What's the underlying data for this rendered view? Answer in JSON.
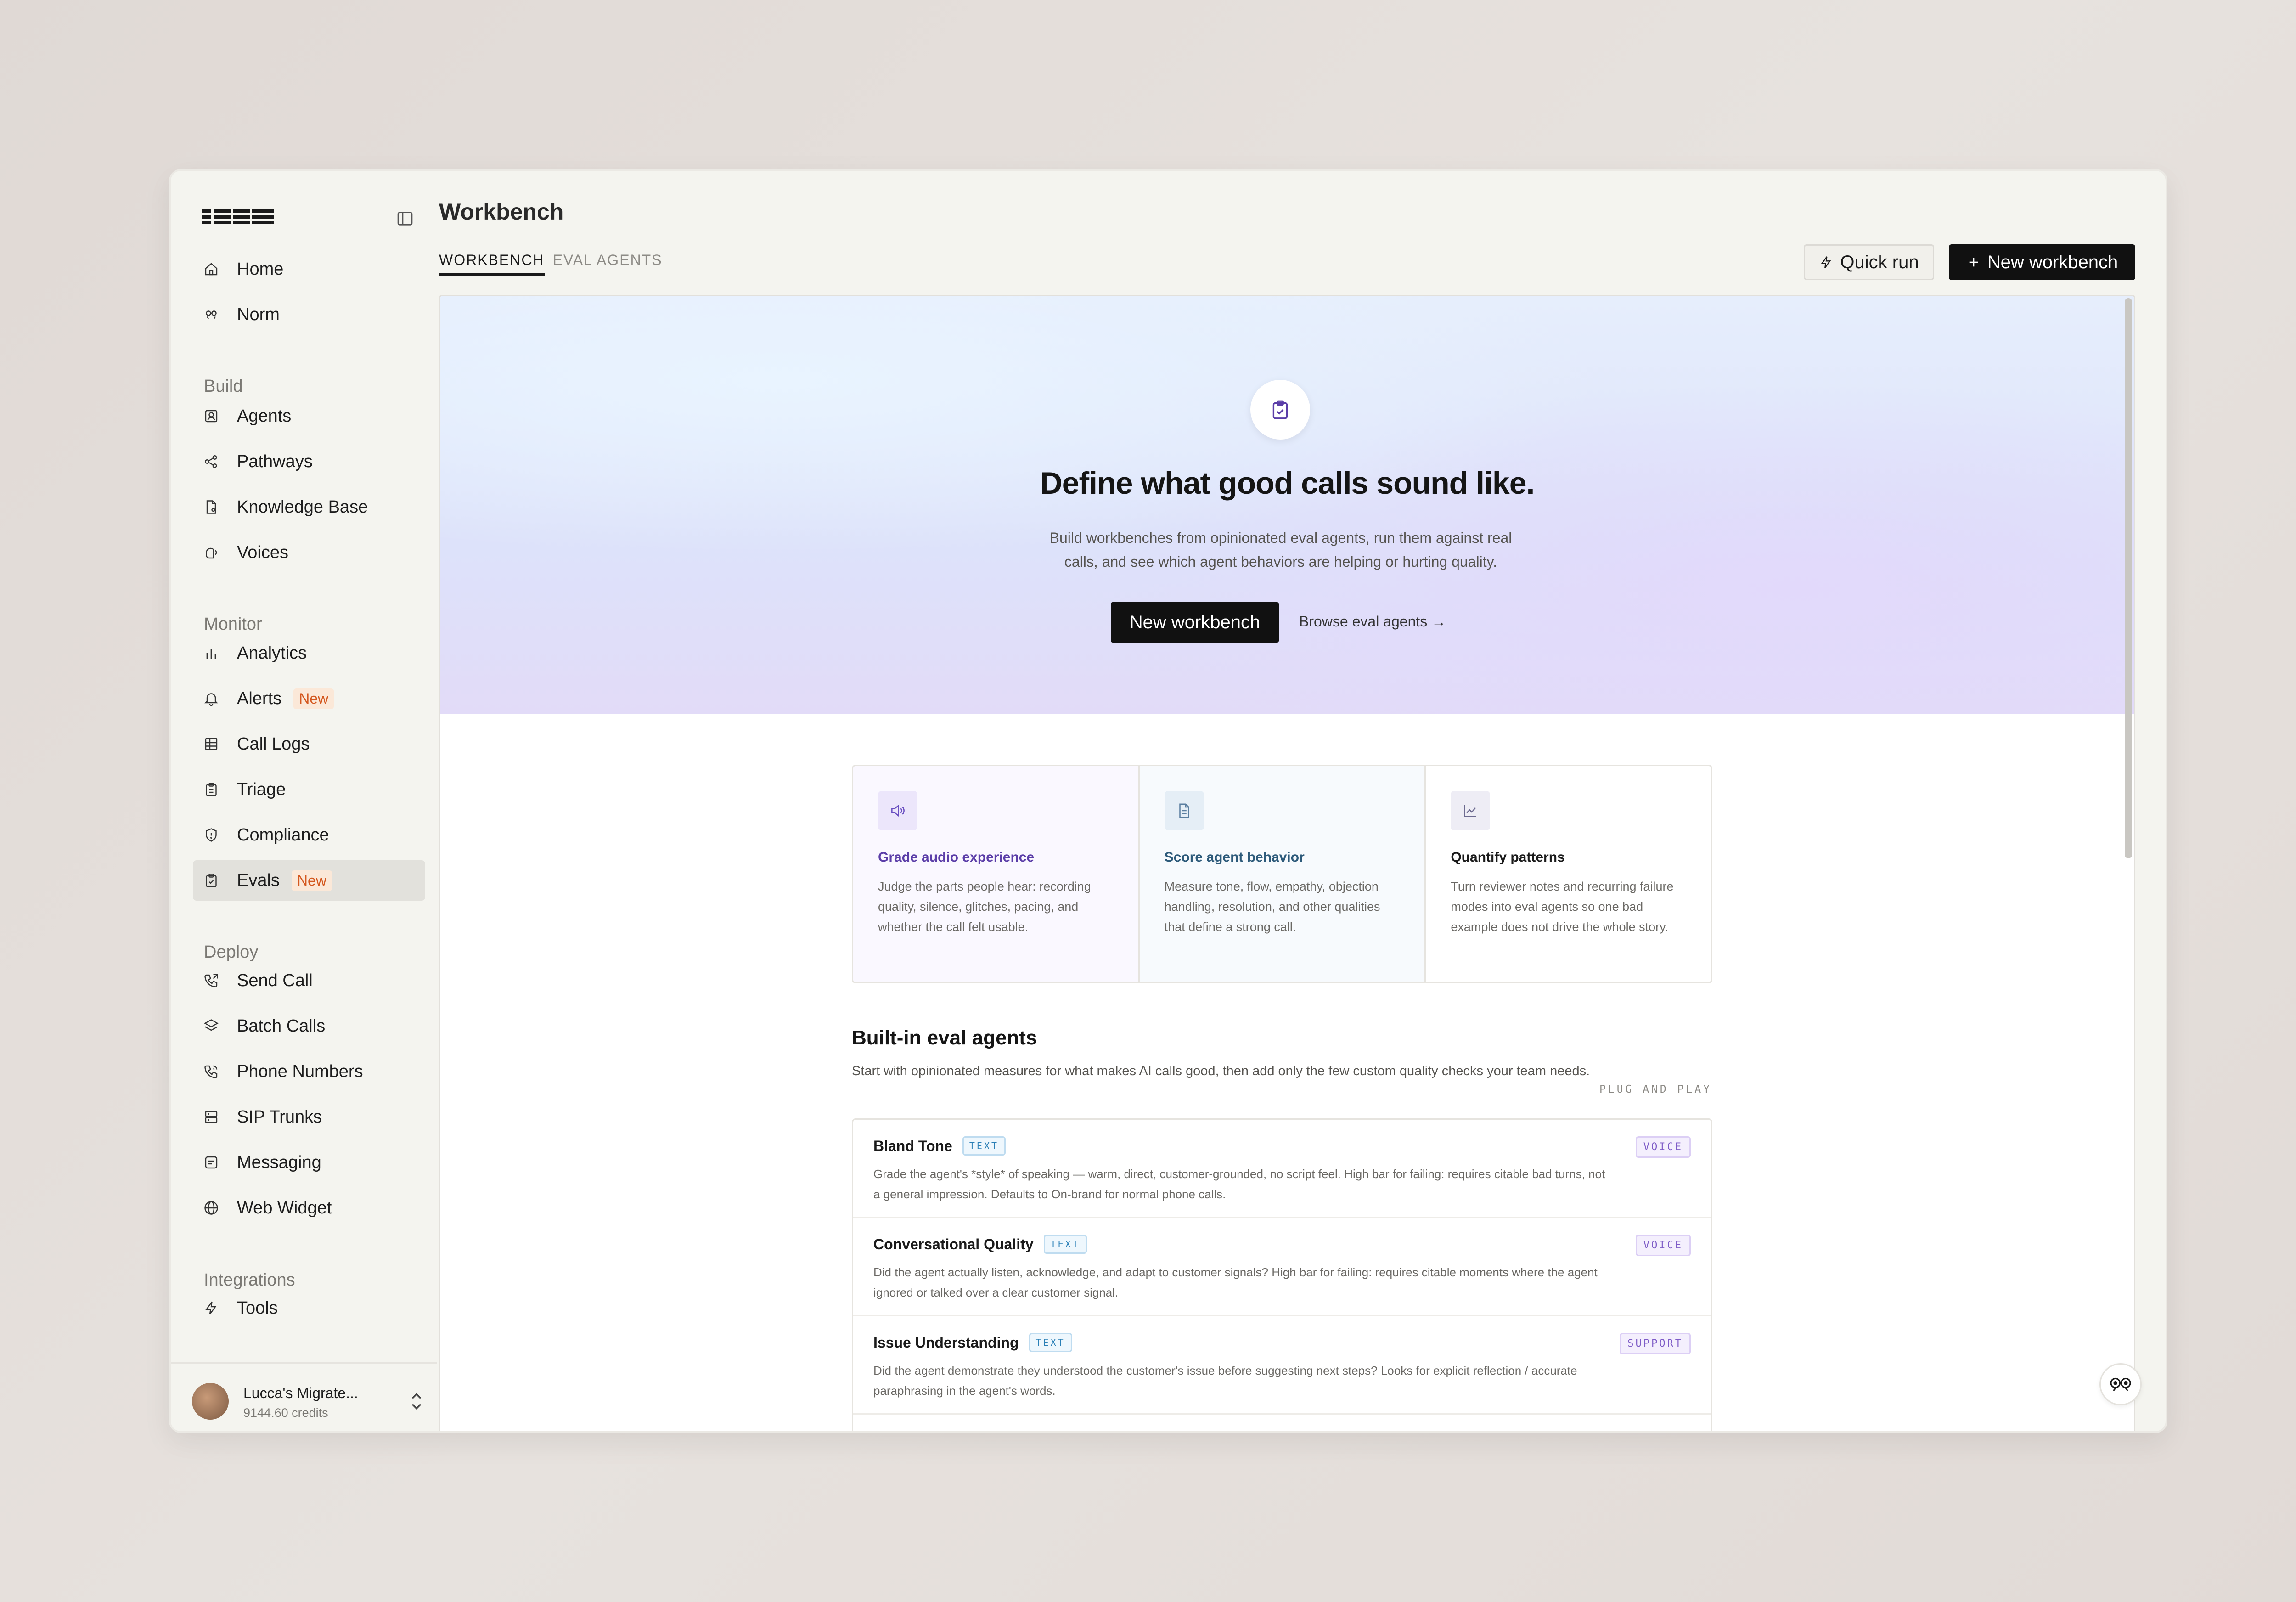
{
  "app": {
    "page_title": "Workbench"
  },
  "sidebar": {
    "top_items": [
      {
        "label": "Home",
        "icon": "home-icon"
      },
      {
        "label": "Norm",
        "icon": "norm-icon"
      }
    ],
    "sections": [
      {
        "label": "Build",
        "items": [
          {
            "label": "Agents",
            "icon": "agent-icon"
          },
          {
            "label": "Pathways",
            "icon": "share-icon"
          },
          {
            "label": "Knowledge Base",
            "icon": "file-icon"
          },
          {
            "label": "Voices",
            "icon": "voice-icon"
          }
        ]
      },
      {
        "label": "Monitor",
        "items": [
          {
            "label": "Analytics",
            "icon": "bar-chart-icon"
          },
          {
            "label": "Alerts",
            "icon": "bell-icon",
            "badge": "New"
          },
          {
            "label": "Call Logs",
            "icon": "table-icon"
          },
          {
            "label": "Triage",
            "icon": "clipboard-icon"
          },
          {
            "label": "Compliance",
            "icon": "shield-icon"
          },
          {
            "label": "Evals",
            "icon": "clipboard-check-icon",
            "badge": "New",
            "active": true
          }
        ]
      },
      {
        "label": "Deploy",
        "items": [
          {
            "label": "Send Call",
            "icon": "phone-outgoing-icon"
          },
          {
            "label": "Batch Calls",
            "icon": "layers-icon"
          },
          {
            "label": "Phone Numbers",
            "icon": "phone-icon"
          },
          {
            "label": "SIP Trunks",
            "icon": "server-icon"
          },
          {
            "label": "Messaging",
            "icon": "message-icon"
          },
          {
            "label": "Web Widget",
            "icon": "globe-icon"
          }
        ]
      },
      {
        "label": "Integrations",
        "items": [
          {
            "label": "Tools",
            "icon": "bolt-icon"
          }
        ]
      }
    ],
    "account": {
      "name": "Lucca's Migrate...",
      "credits": "9144.60 credits"
    }
  },
  "header": {
    "tabs": [
      {
        "label": "WORKBENCH",
        "active": true
      },
      {
        "label": "EVAL AGENTS",
        "active": false
      }
    ],
    "quick_run_label": "Quick run",
    "new_workbench_label": "New workbench"
  },
  "hero": {
    "title": "Define what good calls sound like.",
    "subtitle": "Build workbenches from opinionated eval agents, run them against real calls, and see which agent behaviors are helping or hurting quality.",
    "primary_button": "New workbench",
    "link": "Browse eval agents →"
  },
  "features": [
    {
      "title": "Grade audio experience",
      "description": "Judge the parts people hear: recording quality, silence, glitches, pacing, and whether the call felt usable.",
      "icon": "speaker-icon",
      "color": "#5b3ea8"
    },
    {
      "title": "Score agent behavior",
      "description": "Measure tone, flow, empathy, objection handling, resolution, and other qualities that define a strong call.",
      "icon": "document-icon",
      "color": "#2d5a7a"
    },
    {
      "title": "Quantify patterns",
      "description": "Turn reviewer notes and recurring failure modes into eval agents so one bad example does not drive the whole story.",
      "icon": "line-chart-icon",
      "color": "#1a1a1a"
    }
  ],
  "builtin": {
    "title": "Built-in eval agents",
    "subtitle": "Start with opinionated measures for what makes AI calls good, then add only the few custom quality checks your team needs.",
    "tag": "PLUG AND PLAY",
    "agents": [
      {
        "name": "Bland Tone",
        "type": "TEXT",
        "category": "VOICE",
        "description": "Grade the agent's *style* of speaking — warm, direct, customer-grounded, no script feel. High bar for failing: requires citable bad turns, not a general impression. Defaults to On-brand for normal phone calls."
      },
      {
        "name": "Conversational Quality",
        "type": "TEXT",
        "category": "VOICE",
        "description": "Did the agent actually listen, acknowledge, and adapt to customer signals? High bar for failing: requires citable moments where the agent ignored or talked over a clear customer signal."
      },
      {
        "name": "Issue Understanding",
        "type": "TEXT",
        "category": "SUPPORT",
        "description": "Did the agent demonstrate they understood the customer's issue before suggesting next steps? Looks for explicit reflection / accurate paraphrasing in the agent's words."
      }
    ]
  },
  "colors": {
    "accent_new": "#d4581f",
    "primary_button": "#111111",
    "text_tag": "#2a7fb6",
    "category_tag": "#7e5cc7"
  }
}
